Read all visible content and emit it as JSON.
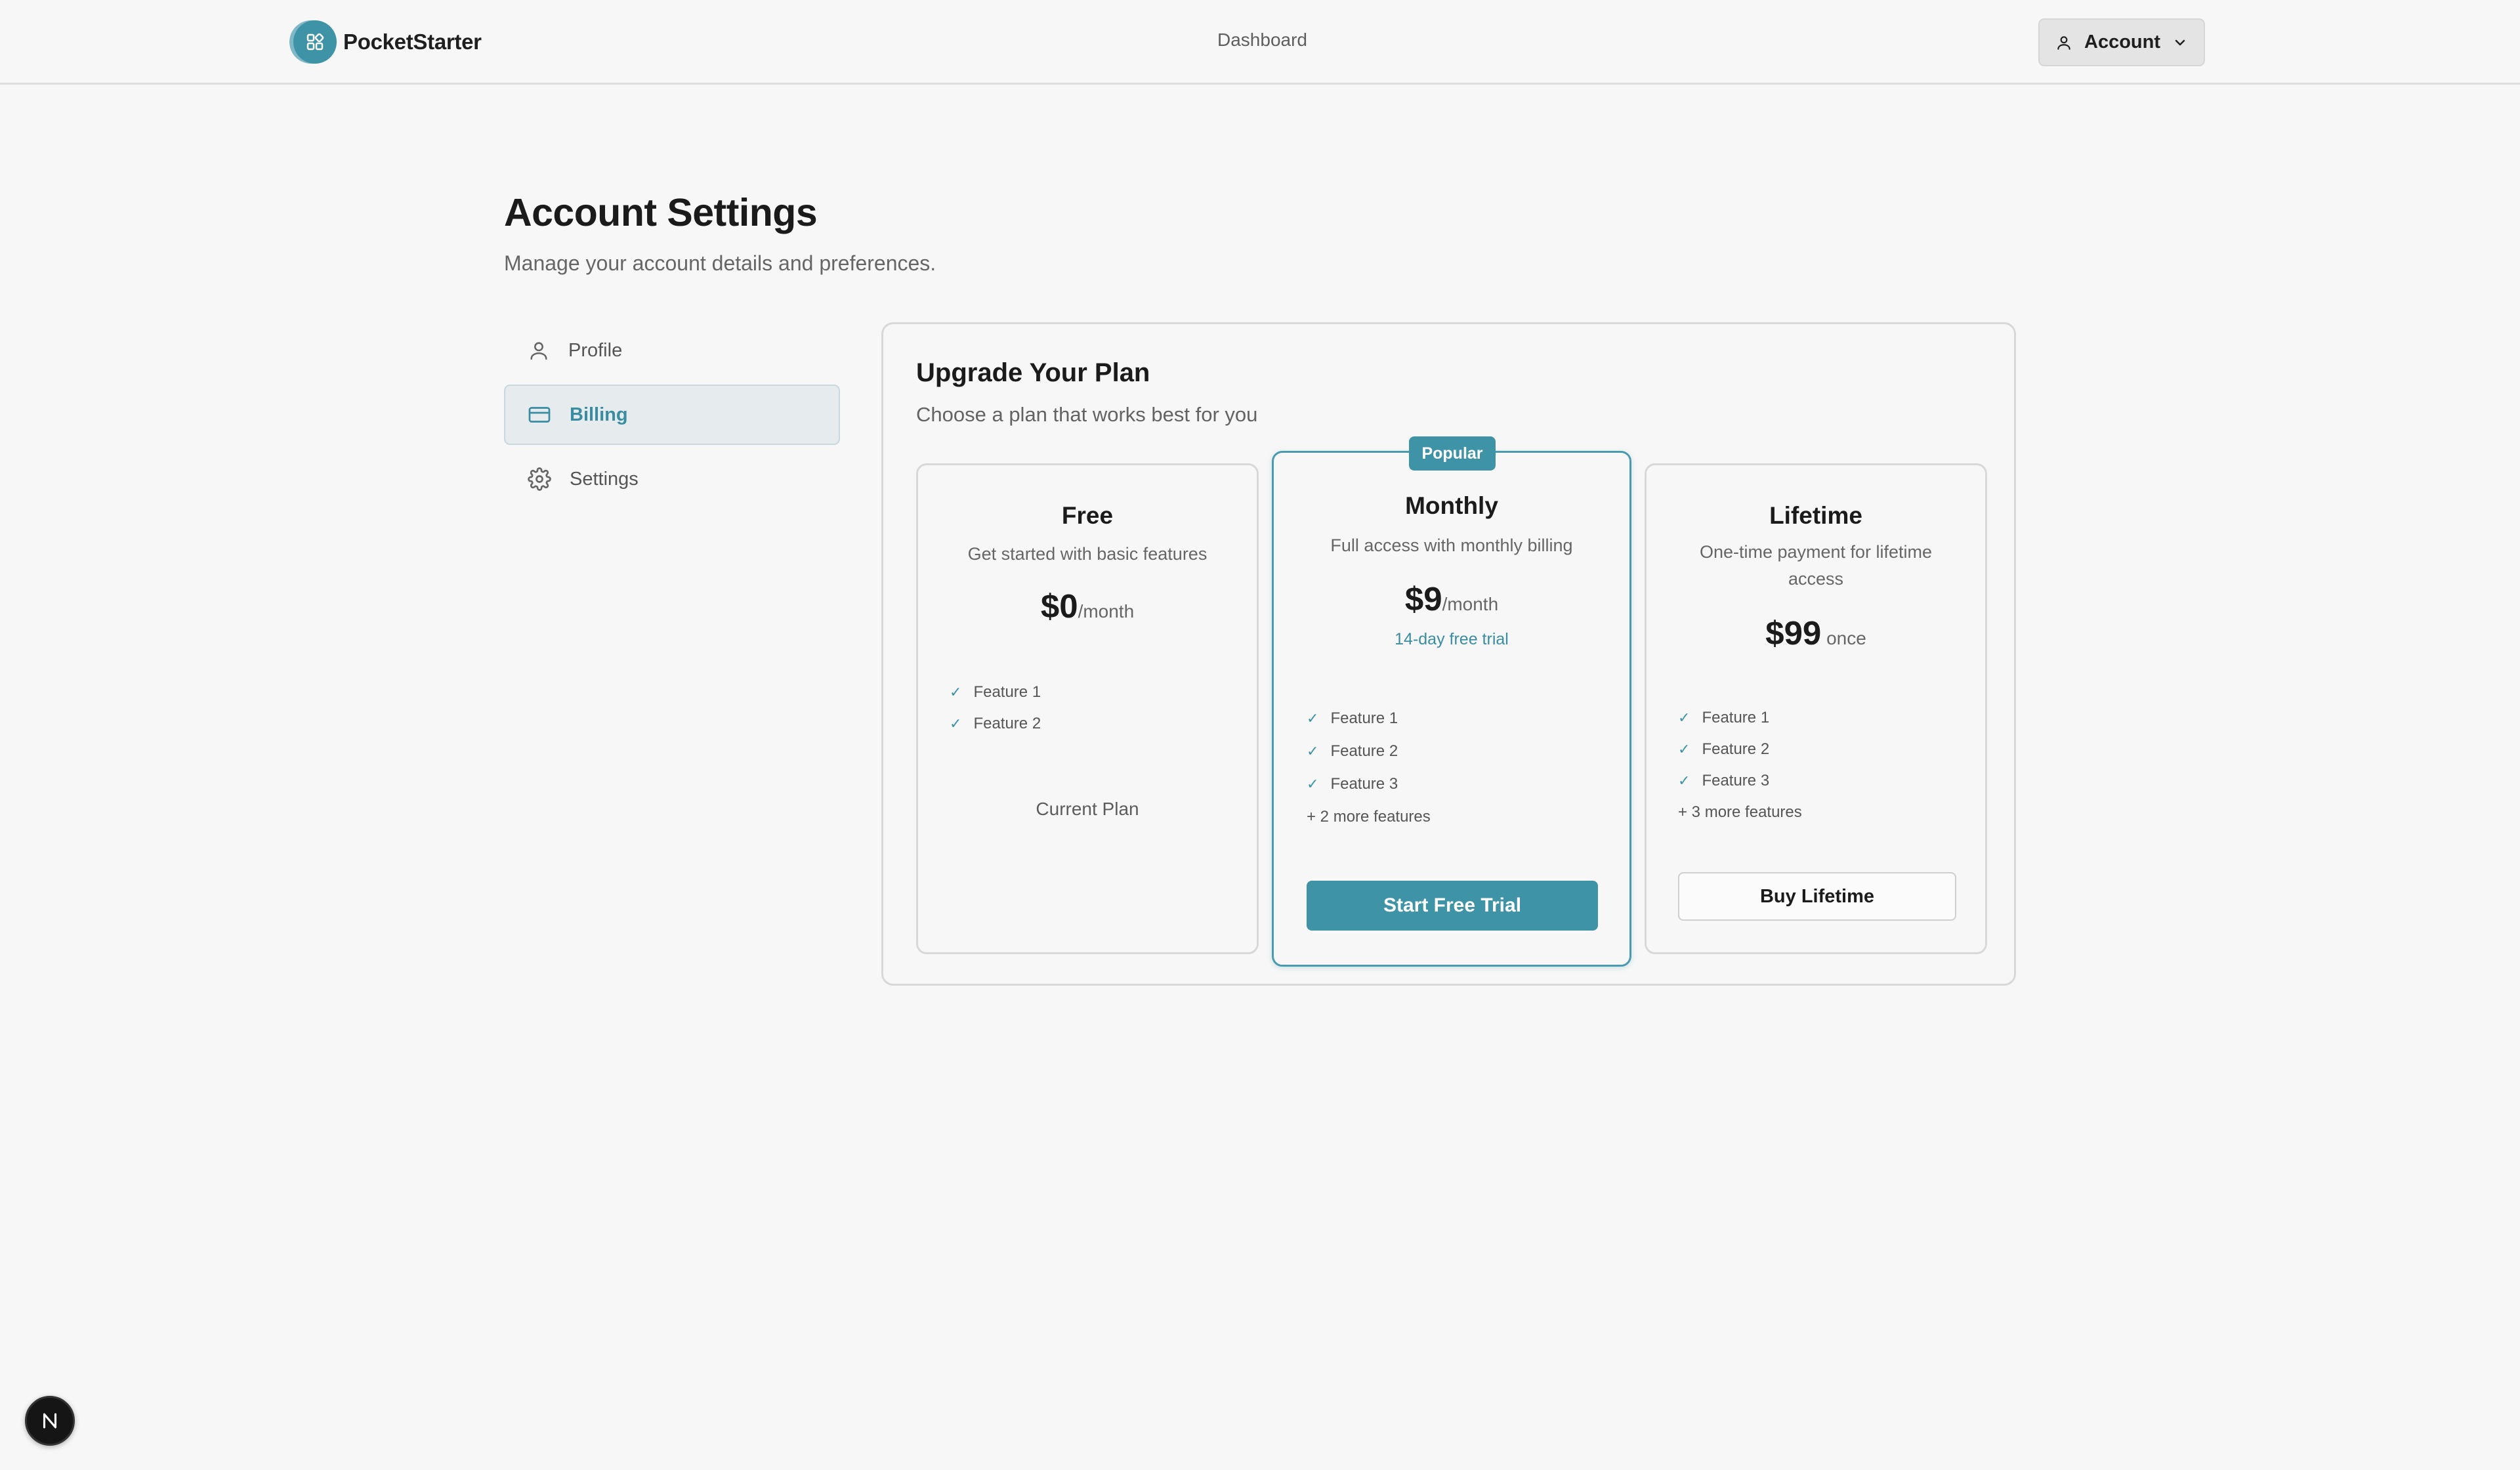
{
  "header": {
    "brand": "PocketStarter",
    "nav_dashboard": "Dashboard",
    "account_label": "Account"
  },
  "page": {
    "title": "Account Settings",
    "subtitle": "Manage your account details and preferences."
  },
  "sidebar": {
    "items": [
      {
        "label": "Profile",
        "icon": "user-icon",
        "active": false
      },
      {
        "label": "Billing",
        "icon": "credit-card-icon",
        "active": true
      },
      {
        "label": "Settings",
        "icon": "gear-icon",
        "active": false
      }
    ]
  },
  "plans_panel": {
    "title": "Upgrade Your Plan",
    "subtitle": "Choose a plan that works best for you",
    "plans": [
      {
        "name": "Free",
        "description": "Get started with basic features",
        "price": "$0",
        "period": "/month",
        "features": [
          "Feature 1",
          "Feature 2"
        ],
        "action": "Current Plan"
      },
      {
        "name": "Monthly",
        "badge": "Popular",
        "description": "Full access with monthly billing",
        "price": "$9",
        "period": "/month",
        "trial": "14-day free trial",
        "features": [
          "Feature 1",
          "Feature 2",
          "Feature 3"
        ],
        "more": "+ 2 more features",
        "action": "Start Free Trial"
      },
      {
        "name": "Lifetime",
        "description": "One-time payment for lifetime access",
        "price": "$99",
        "period": " once",
        "features": [
          "Feature 1",
          "Feature 2",
          "Feature 3"
        ],
        "more": "+ 3 more features",
        "action": "Buy Lifetime"
      }
    ]
  },
  "colors": {
    "accent": "#3f93a6",
    "background": "#f7f7f7"
  }
}
